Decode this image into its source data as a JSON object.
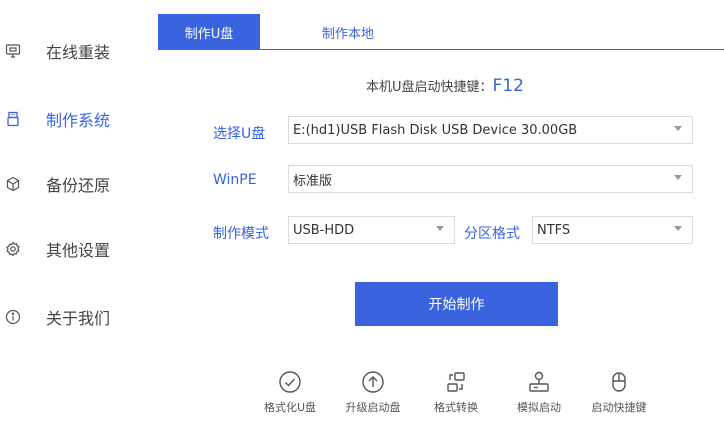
{
  "sidebar": {
    "items": [
      {
        "label": "在线重装",
        "icon": "monitor-icon"
      },
      {
        "label": "制作系统",
        "icon": "usb-drive-icon"
      },
      {
        "label": "备份还原",
        "icon": "cube-backup-icon"
      },
      {
        "label": "其他设置",
        "icon": "gear-icon"
      },
      {
        "label": "关于我们",
        "icon": "info-icon"
      }
    ],
    "active_index": 1
  },
  "tabs": [
    {
      "label": "制作U盘",
      "active": true
    },
    {
      "label": "制作本地",
      "active": false
    }
  ],
  "hotkey": {
    "label": "本机U盘启动快捷键：",
    "key": "F12"
  },
  "form": {
    "usb": {
      "label": "选择U盘",
      "value": "E:(hd1)USB Flash Disk USB Device 30.00GB"
    },
    "winpe": {
      "label": "WinPE",
      "value": "标准版"
    },
    "mode": {
      "label": "制作模式",
      "value": "USB-HDD"
    },
    "partition": {
      "label": "分区格式",
      "value": "NTFS"
    }
  },
  "start_button": "开始制作",
  "tools": [
    {
      "label": "格式化U盘",
      "icon": "check-circle-icon"
    },
    {
      "label": "升级启动盘",
      "icon": "upload-circle-icon"
    },
    {
      "label": "格式转换",
      "icon": "convert-icon"
    },
    {
      "label": "模拟启动",
      "icon": "simulate-icon"
    },
    {
      "label": "启动快捷键",
      "icon": "mouse-icon"
    }
  ],
  "colors": {
    "accent": "#3a63e0",
    "border": "#dcdcdc"
  }
}
